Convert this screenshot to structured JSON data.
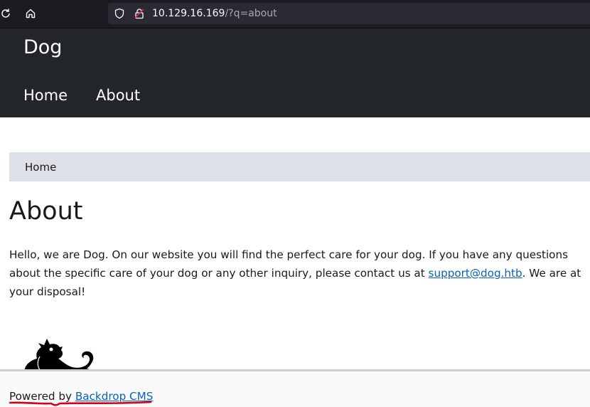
{
  "browser": {
    "url_host": "10.129.16.169",
    "url_path": "/?q=about"
  },
  "site": {
    "name": "Dog",
    "menu": [
      "Home",
      "About"
    ]
  },
  "breadcrumb": {
    "home_label": "Home"
  },
  "page": {
    "title": "About",
    "body_before_link": "Hello, we are Dog. On our website you will find the perfect care for your dog. If you have any questions about the specific care of your dog or any other inquiry, please contact us at ",
    "email_link": "support@dog.htb",
    "body_after_link": ". We are at your disposal!"
  },
  "footer": {
    "powered_by": "Powered by ",
    "cms_link": "Backdrop CMS"
  },
  "colors": {
    "header_bg": "#232628",
    "breadcrumb_bg": "#dde1e7",
    "link": "#0b61b4",
    "annotation_red": "#d0021b"
  }
}
